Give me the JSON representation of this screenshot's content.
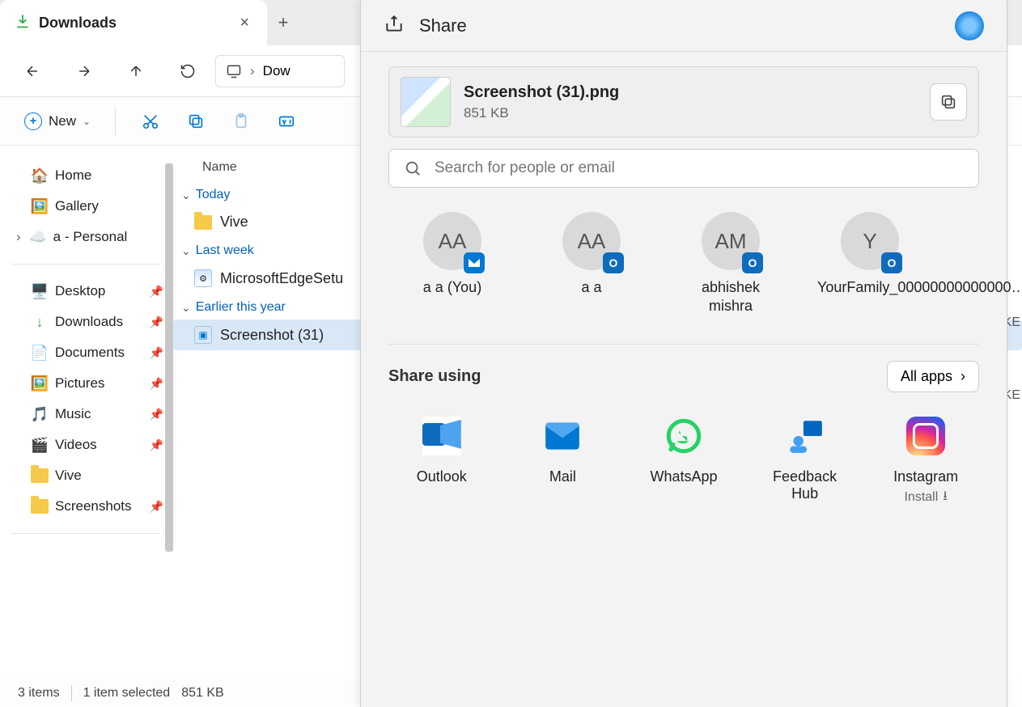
{
  "tab": {
    "title": "Downloads"
  },
  "address": {
    "crumb": "Dow"
  },
  "cmdbar": {
    "new_label": "New"
  },
  "nav": {
    "home": "Home",
    "gallery": "Gallery",
    "personal": "a - Personal",
    "desktop": "Desktop",
    "downloads": "Downloads",
    "documents": "Documents",
    "pictures": "Pictures",
    "music": "Music",
    "videos": "Videos",
    "vive": "Vive",
    "screenshots": "Screenshots"
  },
  "content": {
    "col_name": "Name",
    "groups": {
      "today": "Today",
      "last_week": "Last week",
      "earlier_this_year": "Earlier this year"
    },
    "items": {
      "vive": "Vive",
      "edge": "MicrosoftEdgeSetu",
      "screenshot": "Screenshot (31)"
    }
  },
  "status": {
    "count": "3 items",
    "selected": "1 item selected",
    "size": "851 KB"
  },
  "bgcol": {
    "l1": "KE",
    "l2": "KE"
  },
  "share": {
    "title": "Share",
    "file_name": "Screenshot (31).png",
    "file_size": "851 KB",
    "search_placeholder": "Search for people or email",
    "contacts": [
      {
        "initials": "AA",
        "name": "a a (You)",
        "badge": "mail"
      },
      {
        "initials": "AA",
        "name": "a a",
        "badge": "outlook"
      },
      {
        "initials": "AM",
        "name": "abhishek mishra",
        "badge": "outlook"
      },
      {
        "initials": "Y",
        "name": "YourFamily_00000000000000…",
        "badge": "outlook"
      }
    ],
    "share_using": "Share using",
    "all_apps": "All apps",
    "apps": {
      "outlook": "Outlook",
      "mail": "Mail",
      "whatsapp": "WhatsApp",
      "feedback": "Feedback Hub",
      "instagram": "Instagram",
      "install": "Install"
    }
  }
}
